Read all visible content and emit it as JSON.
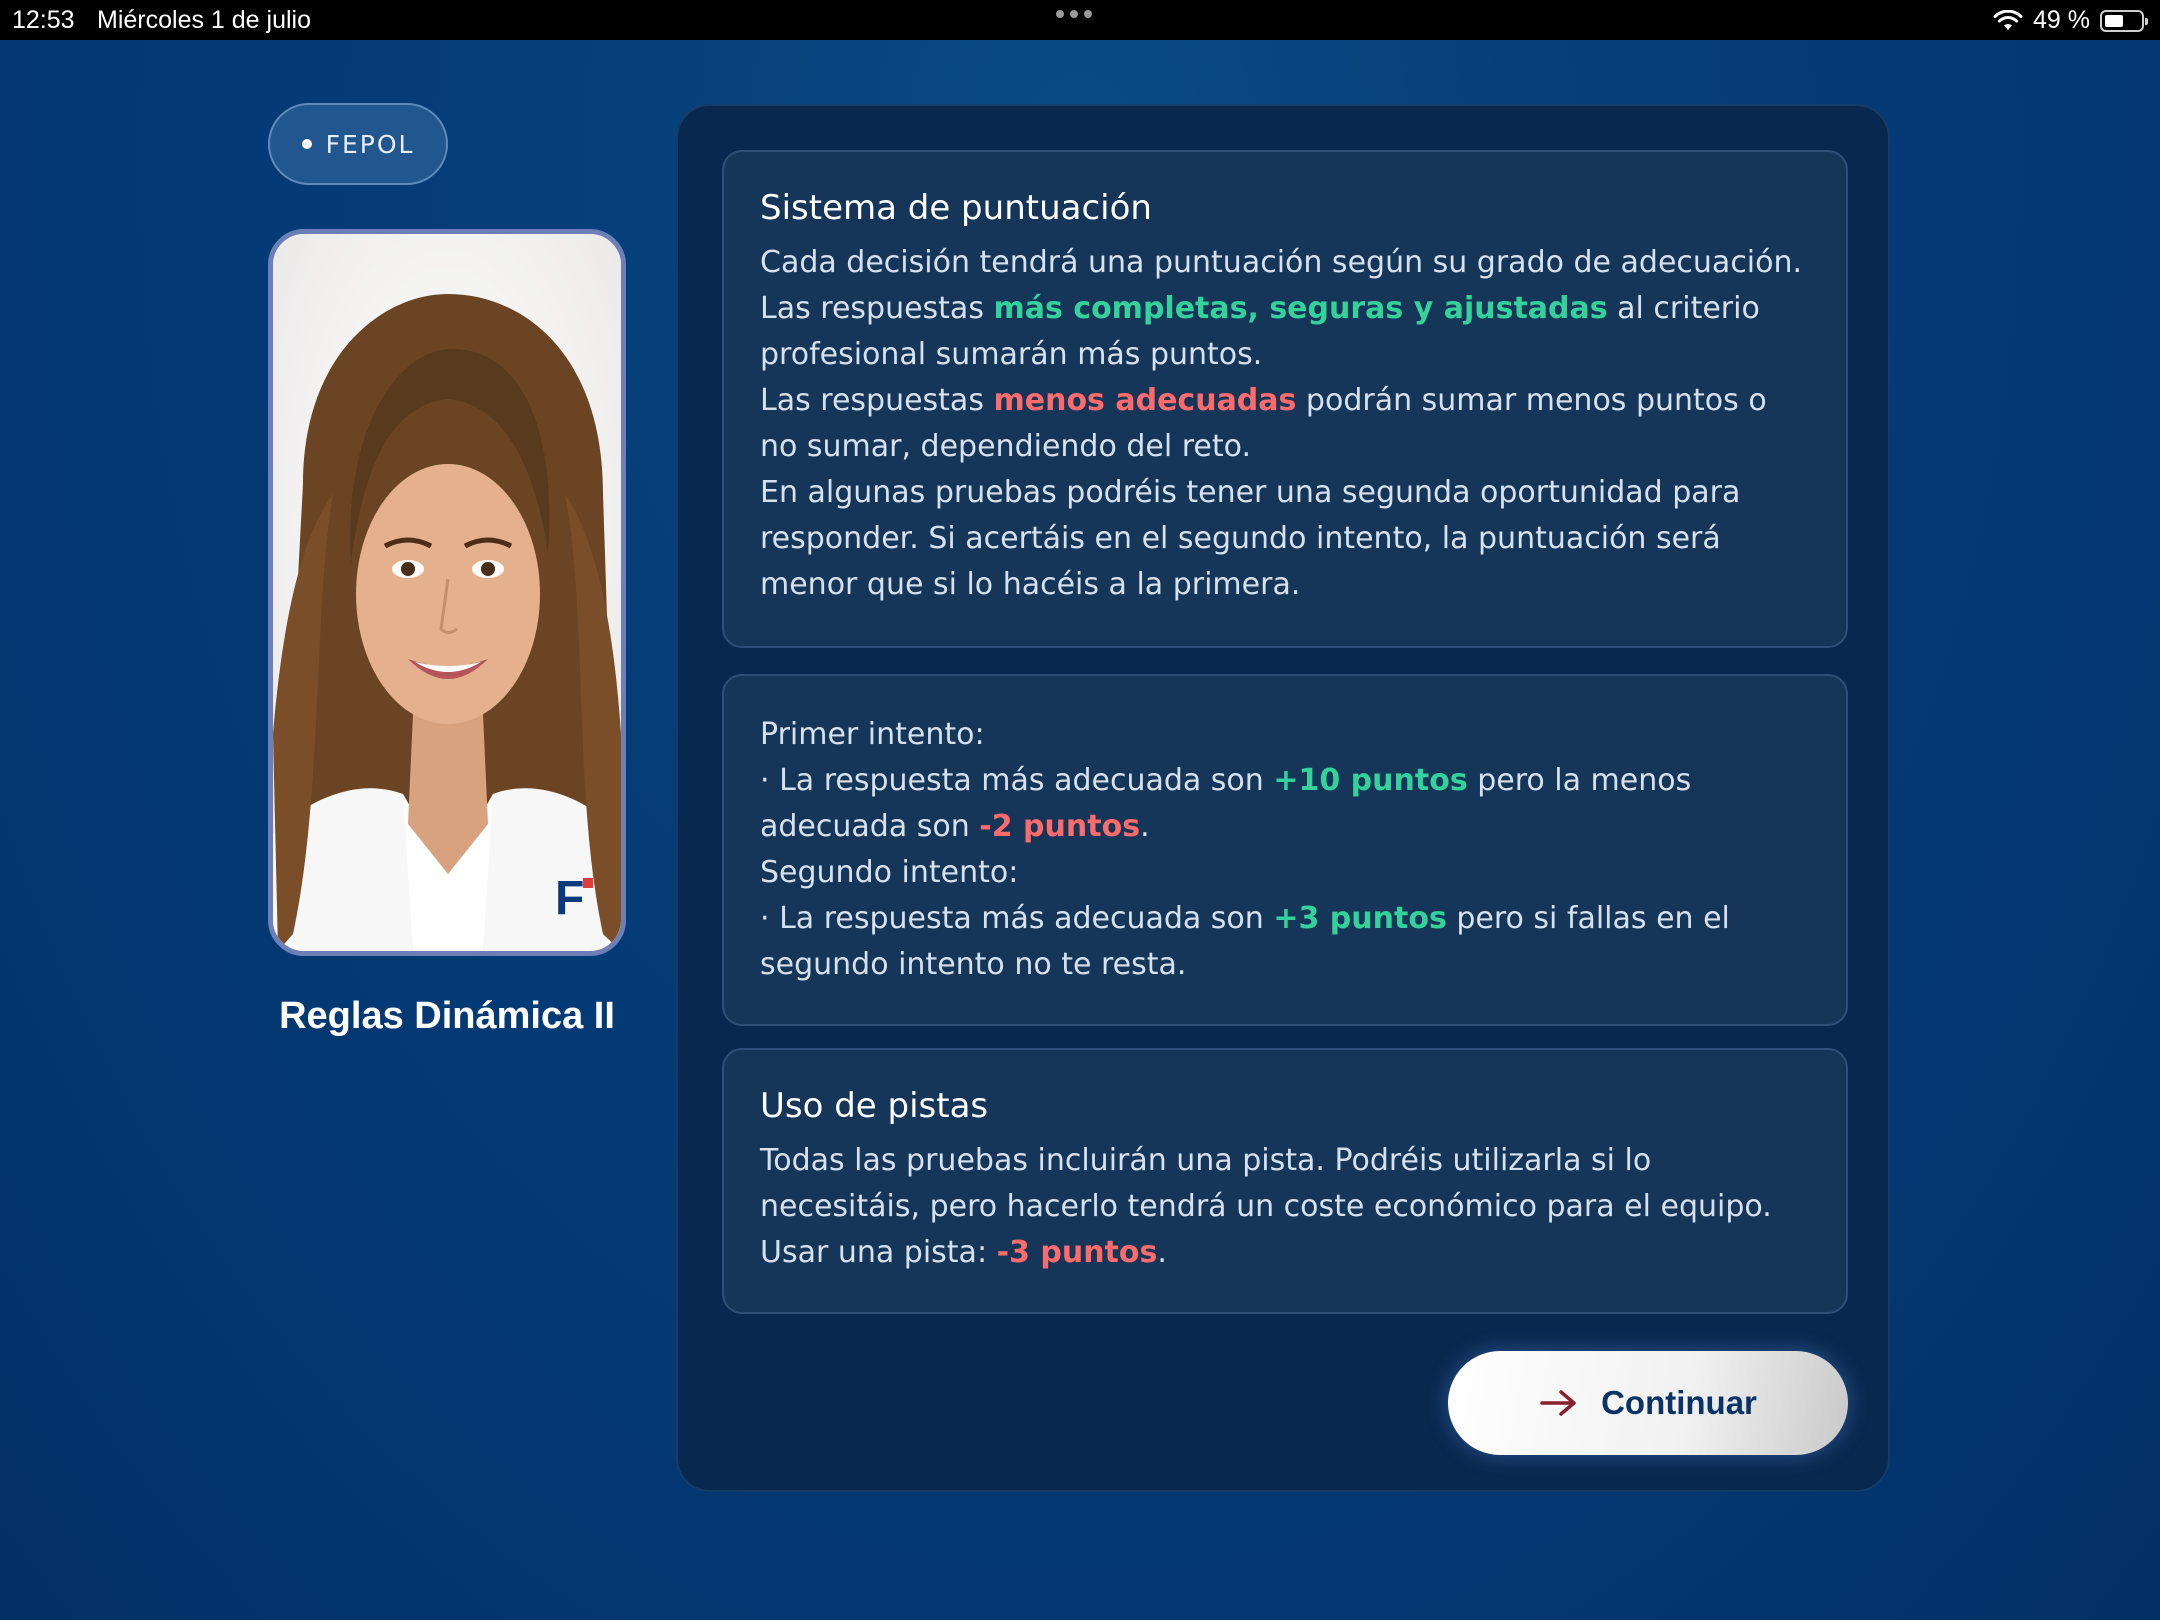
{
  "status_bar": {
    "time": "12:53",
    "date": "Miércoles 1 de julio",
    "battery": "49 %"
  },
  "badge": {
    "label": "FEPOL"
  },
  "portrait": {
    "alt": "avatar",
    "logo_text": "F"
  },
  "left_title": "Reglas Dinámica II",
  "scoring_card": {
    "title": "Sistema de puntuación",
    "p1_a": "Cada decisión tendrá una puntuación según su grado de adecuación. Las respuestas ",
    "p1_hl": "más completas, seguras y ajustadas",
    "p1_b": " al criterio profesional sumarán más puntos.",
    "p2_a": "Las respuestas ",
    "p2_hl": "menos adecuadas",
    "p2_b": " podrán sumar menos puntos o no sumar, dependiendo del reto.",
    "p3": "En algunas pruebas podréis tener una segunda oportunidad para responder. Si acertáis en el segundo intento, la puntuación será menor que si lo hacéis a la primera."
  },
  "attempts_card": {
    "first_label": "Primer intento:",
    "first_a": "· La respuesta más adecuada son ",
    "first_hl1": "+10 puntos",
    "first_b": " pero la menos adecuada son ",
    "first_hl2": "-2 puntos",
    "first_c": ".",
    "second_label": "Segundo intento:",
    "second_a": "· La respuesta más adecuada son ",
    "second_hl": "+3 puntos",
    "second_b": " pero si fallas en el segundo intento no te resta."
  },
  "hints_card": {
    "title": "Uso de pistas",
    "p1": "Todas las pruebas incluirán una pista. Podréis utilizarla si lo necesitáis, pero hacerlo tendrá un coste económico para el equipo.",
    "p2_a": "Usar una pista: ",
    "p2_hl": "-3 puntos",
    "p2_b": "."
  },
  "continue_button": {
    "label": "Continuar",
    "icon": "arrow-right-icon"
  },
  "colors": {
    "positive": "#34d29a",
    "negative": "#ff6b6b",
    "accent_dark": "#0a3466"
  }
}
